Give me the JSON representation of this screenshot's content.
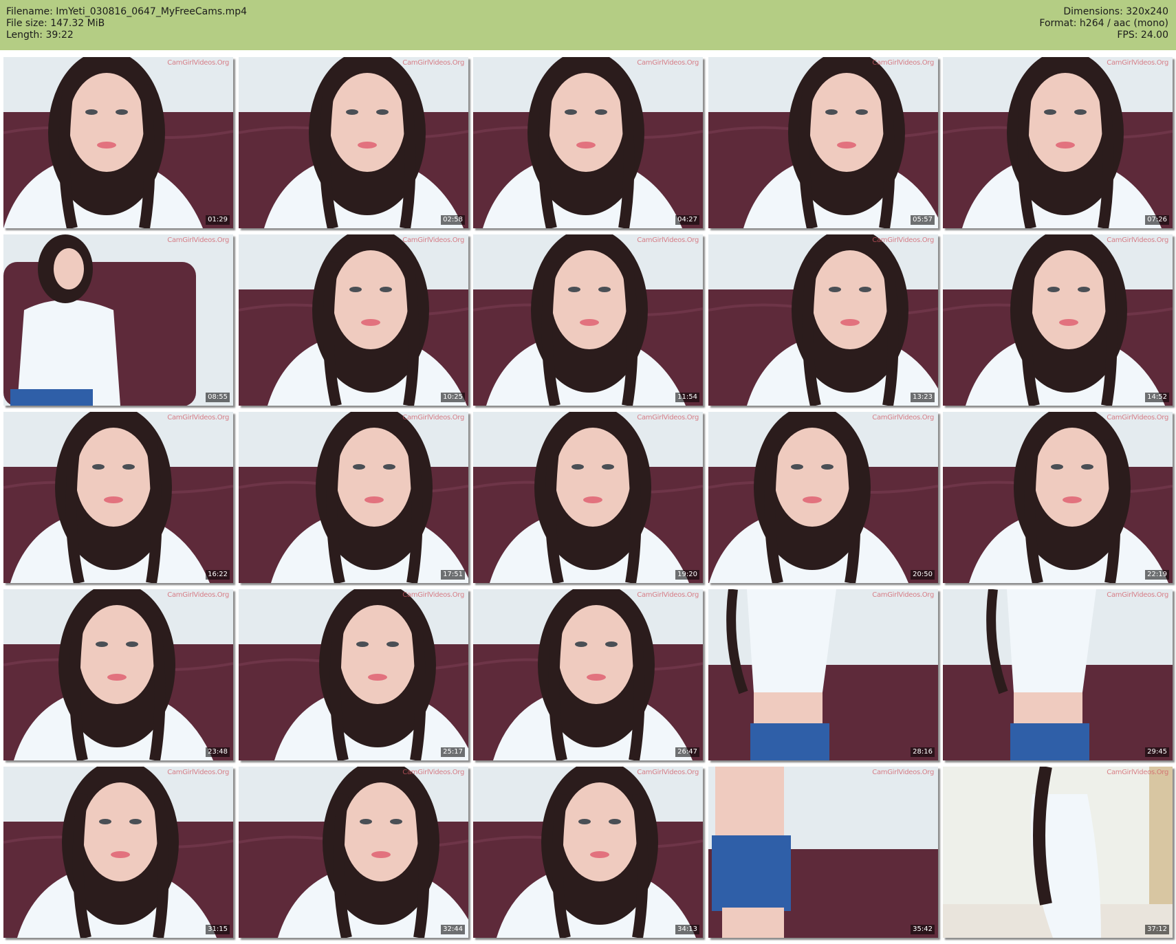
{
  "header": {
    "filename_line": "Filename: ImYeti_030816_0647_MyFreeCams.mp4",
    "filesize_line": "File size: 147.32 MiB",
    "length_line": "Length: 39:22",
    "dimensions_line": "Dimensions: 320x240",
    "format_line": "Format: h264 / aac (mono)",
    "fps_line": "FPS: 24.00"
  },
  "colors": {
    "header_bg": "#b4cd84",
    "couch": "#5e2a3a",
    "wall": "#e4ebef",
    "sweater": "#f2f7fb",
    "hair": "#2b1c1c",
    "skin": "#efcbbf",
    "shorts": "#2f5fa8"
  },
  "watermark": "CamGirlVideos.Org",
  "thumbnails": [
    {
      "time": "01:29",
      "scene": "face"
    },
    {
      "time": "02:58",
      "scene": "face"
    },
    {
      "time": "04:27",
      "scene": "face"
    },
    {
      "time": "05:57",
      "scene": "face"
    },
    {
      "time": "07:26",
      "scene": "face"
    },
    {
      "time": "08:55",
      "scene": "seated"
    },
    {
      "time": "10:25",
      "scene": "face"
    },
    {
      "time": "11:54",
      "scene": "face"
    },
    {
      "time": "13:23",
      "scene": "face"
    },
    {
      "time": "14:52",
      "scene": "face"
    },
    {
      "time": "16:22",
      "scene": "face"
    },
    {
      "time": "17:51",
      "scene": "face"
    },
    {
      "time": "19:20",
      "scene": "face"
    },
    {
      "time": "20:50",
      "scene": "face"
    },
    {
      "time": "22:19",
      "scene": "face"
    },
    {
      "time": "23:48",
      "scene": "face"
    },
    {
      "time": "25:17",
      "scene": "face"
    },
    {
      "time": "26:47",
      "scene": "face"
    },
    {
      "time": "28:16",
      "scene": "standing"
    },
    {
      "time": "29:45",
      "scene": "standing"
    },
    {
      "time": "31:15",
      "scene": "face"
    },
    {
      "time": "32:44",
      "scene": "face"
    },
    {
      "time": "34:13",
      "scene": "face"
    },
    {
      "time": "35:42",
      "scene": "torso"
    },
    {
      "time": "37:12",
      "scene": "room"
    }
  ]
}
